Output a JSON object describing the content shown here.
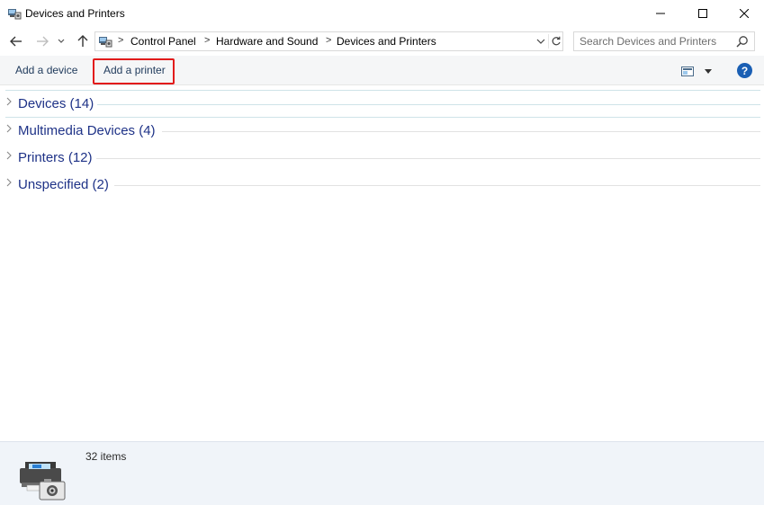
{
  "window": {
    "title": "Devices and Printers",
    "icons": {
      "app": "devices-printers-icon"
    }
  },
  "nav": {
    "back_icon": "arrow-left-icon",
    "forward_icon": "arrow-right-icon",
    "recent_icon": "chevron-down-icon",
    "up_icon": "arrow-up-icon"
  },
  "address": {
    "crumbs": [
      "Control Panel",
      "Hardware and Sound",
      "Devices and Printers"
    ],
    "separator": ">"
  },
  "search": {
    "placeholder": "Search Devices and Printers"
  },
  "commands": {
    "add_device": "Add a device",
    "add_printer": "Add a printer",
    "help": "?",
    "highlight_color": "#e21b1b"
  },
  "groups": [
    {
      "label": "Devices (14)"
    },
    {
      "label": "Multimedia Devices (4)"
    },
    {
      "label": "Printers (12)"
    },
    {
      "label": "Unspecified (2)"
    }
  ],
  "details": {
    "count": "32 items"
  },
  "colors": {
    "group_text": "#1e3287",
    "command_text": "#1e395b",
    "details_bg": "#f0f4f9",
    "help_bg": "#1a5fb4"
  }
}
